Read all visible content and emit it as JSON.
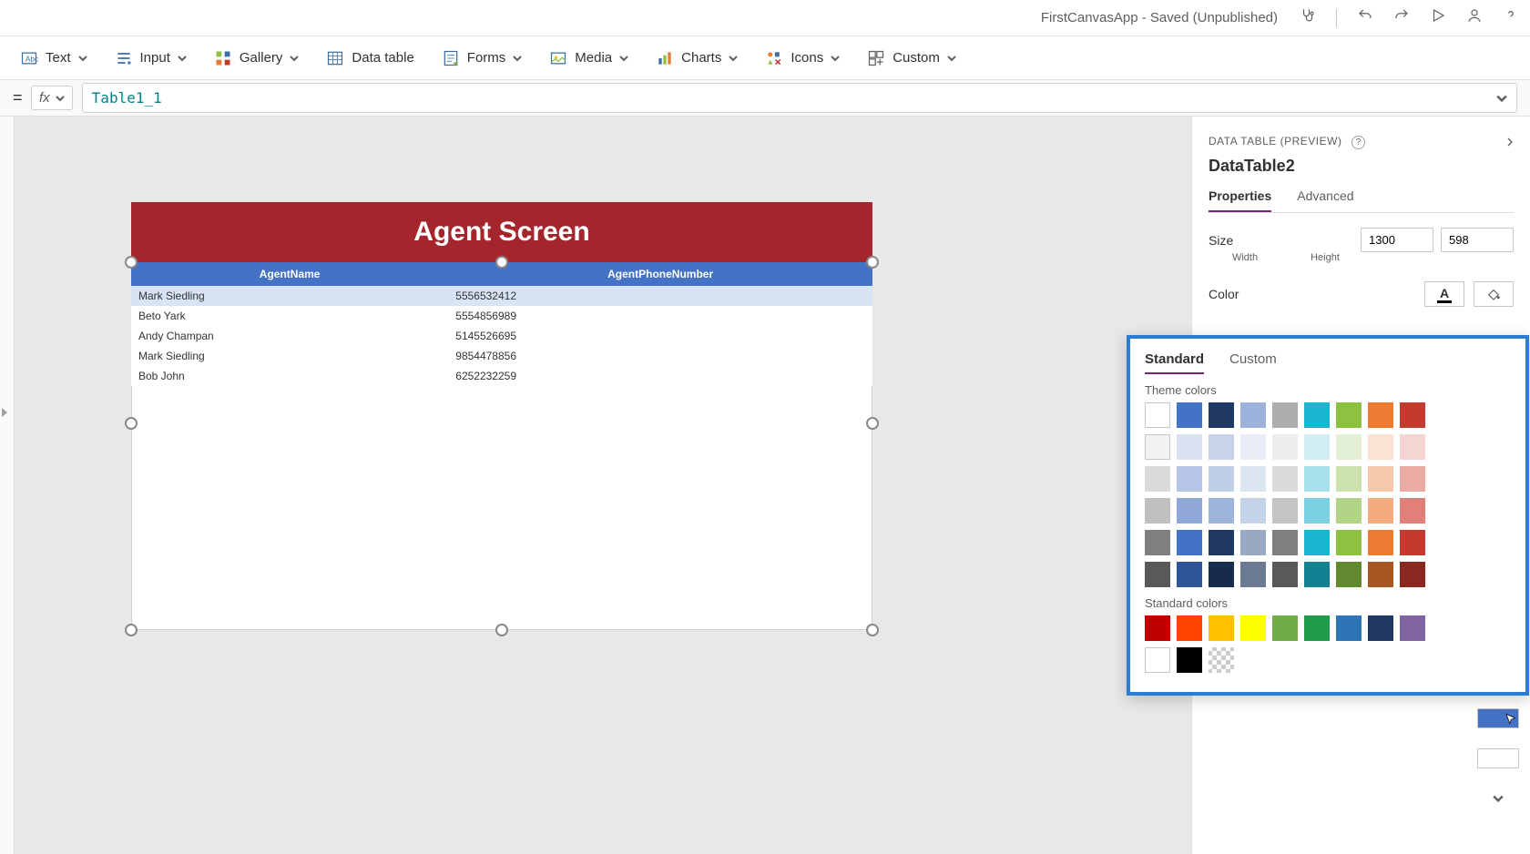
{
  "titlebar": {
    "title": "FirstCanvasApp - Saved (Unpublished)"
  },
  "ribbon": {
    "text": "Text",
    "input": "Input",
    "gallery": "Gallery",
    "datatable": "Data table",
    "forms": "Forms",
    "media": "Media",
    "charts": "Charts",
    "icons": "Icons",
    "custom": "Custom"
  },
  "formula": {
    "value": "Table1_1"
  },
  "canvas": {
    "header": "Agent Screen",
    "columns": [
      "AgentName",
      "AgentPhoneNumber"
    ],
    "rows": [
      {
        "name": "Mark Siedling",
        "phone": "5556532412"
      },
      {
        "name": "Beto Yark",
        "phone": "5554856989"
      },
      {
        "name": "Andy Champan",
        "phone": "5145526695"
      },
      {
        "name": "Mark Siedling",
        "phone": "9854478856"
      },
      {
        "name": "Bob John",
        "phone": "6252232259"
      }
    ]
  },
  "props": {
    "panelLabel": "DATA TABLE (PREVIEW)",
    "objectName": "DataTable2",
    "tabs": {
      "properties": "Properties",
      "advanced": "Advanced"
    },
    "size": {
      "label": "Size",
      "width": "1300",
      "height": "598",
      "widthLabel": "Width",
      "heightLabel": "Height"
    },
    "colorLabel": "Color"
  },
  "picker": {
    "standard": "Standard",
    "custom": "Custom",
    "themeLabel": "Theme colors",
    "standardLabel": "Standard colors",
    "themeRows": [
      [
        "#ffffff",
        "#4472c4",
        "#1f3864",
        "#9cb2da",
        "#adadad",
        "#1ab6cf",
        "#8ec042",
        "#ec7c31",
        "#c53a2f"
      ],
      [
        "#f2f2f2",
        "#d9e2f0",
        "#c7d3e8",
        "#e8ecf5",
        "#ededed",
        "#d2eef4",
        "#e4f0d6",
        "#fbe3d4",
        "#f5d5d2"
      ],
      [
        "#d9d9d9",
        "#b4c5e7",
        "#c1cfe6",
        "#dbe4f1",
        "#dbdbdb",
        "#a7dfeb",
        "#cce2ae",
        "#f7c7a9",
        "#ebaba5"
      ],
      [
        "#bfbfbf",
        "#8fa8d8",
        "#9fb4d9",
        "#c5d3e8",
        "#c4c4c4",
        "#7bd0e2",
        "#b3d486",
        "#f3ab7f",
        "#e18079"
      ],
      [
        "#7f7f7f",
        "#4472c4",
        "#1f3864",
        "#98a9c3",
        "#7f7f7f",
        "#1ab6cf",
        "#8ec042",
        "#ec7c31",
        "#c53a2f"
      ],
      [
        "#595959",
        "#2f5597",
        "#172b4a",
        "#6b7a91",
        "#595959",
        "#128293",
        "#638930",
        "#a95722",
        "#8a2820"
      ]
    ],
    "standardColors": [
      "#c00000",
      "#ff4500",
      "#ffc000",
      "#ffff00",
      "#70ad47",
      "#1f9c4b",
      "#2e75b6",
      "#1f3864",
      "#8064a2"
    ],
    "bwRow": [
      "#ffffff",
      "#000000",
      "#e7e6e6"
    ]
  },
  "rightSwatches": [
    "#0b1f66",
    "",
    "#4a7fd0",
    "#000000",
    "#4472c4",
    ""
  ]
}
